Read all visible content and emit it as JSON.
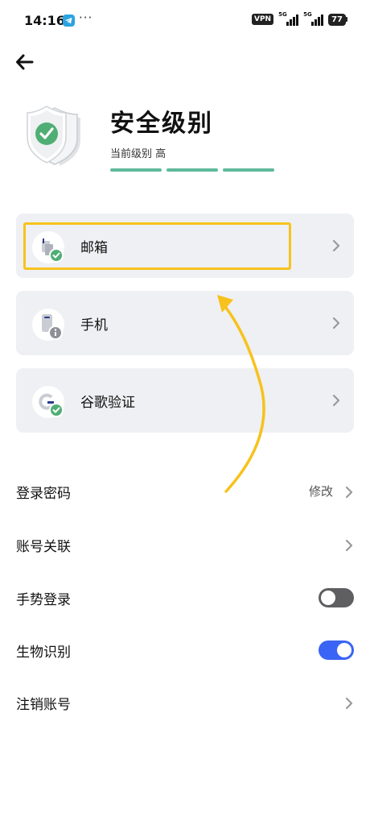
{
  "status_bar": {
    "time": "14:16",
    "dots": "···",
    "vpn": "VPN",
    "network1": "5G",
    "network2": "5G",
    "battery": "77"
  },
  "header": {
    "title": "安全级别",
    "level_text": "当前级别 高",
    "level_bars": 3
  },
  "cards": [
    {
      "label": "邮箱",
      "icon": "email-verified-icon",
      "status": "verified"
    },
    {
      "label": "手机",
      "icon": "phone-info-icon",
      "status": "info"
    },
    {
      "label": "谷歌验证",
      "icon": "google-auth-verified-icon",
      "status": "verified"
    }
  ],
  "settings": [
    {
      "label": "登录密码",
      "value": "修改",
      "control": "chevron"
    },
    {
      "label": "账号关联",
      "control": "chevron"
    },
    {
      "label": "手势登录",
      "control": "toggle",
      "toggle_on": false
    },
    {
      "label": "生物识别",
      "control": "toggle",
      "toggle_on": true
    },
    {
      "label": "注销账号",
      "control": "chevron"
    }
  ],
  "colors": {
    "accent_blue": "#3a64f5",
    "level_green": "#5fb99a",
    "highlight_yellow": "#f7c21d",
    "card_bg": "#eff0f3"
  }
}
